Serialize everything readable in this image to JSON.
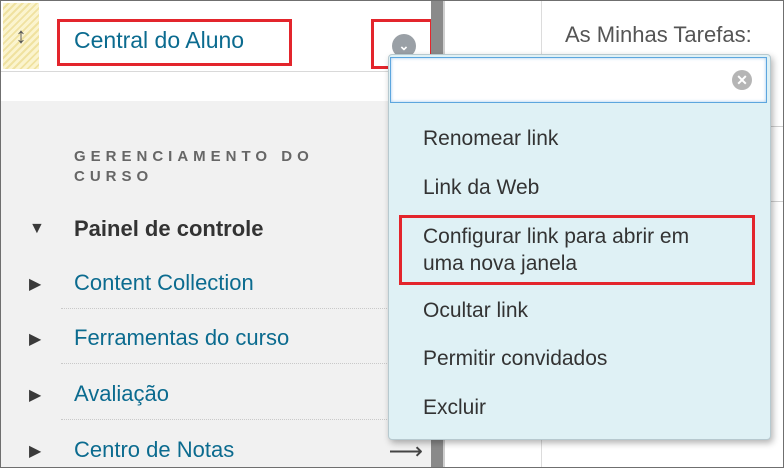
{
  "sidebar": {
    "top_link": "Central do Aluno",
    "section_title_lines": [
      "GERENCIAMENTO DO",
      "CURSO"
    ],
    "items": [
      {
        "label": "Painel de controle",
        "expanded": true
      },
      {
        "label": "Content Collection",
        "expanded": false
      },
      {
        "label": "Ferramentas do curso",
        "expanded": false
      },
      {
        "label": "Avaliação",
        "expanded": false
      },
      {
        "label": "Centro de Notas",
        "expanded": false
      }
    ]
  },
  "content": {
    "title": "As Minhas Tarefas:"
  },
  "menu": {
    "search_value": "",
    "items": [
      {
        "lines": [
          "Renomear link"
        ]
      },
      {
        "lines": [
          "Link da Web"
        ]
      },
      {
        "lines": [
          "Configurar link para abrir em",
          "uma nova janela"
        ]
      },
      {
        "lines": [
          "Ocultar link"
        ]
      },
      {
        "lines": [
          "Permitir convidados"
        ]
      },
      {
        "lines": [
          "Excluir"
        ]
      }
    ]
  },
  "colors": {
    "link": "#0b6b8f",
    "highlight": "#e3252c",
    "menu_bg": "#dff1f5",
    "sidebar_bg": "#f1f1f1"
  }
}
